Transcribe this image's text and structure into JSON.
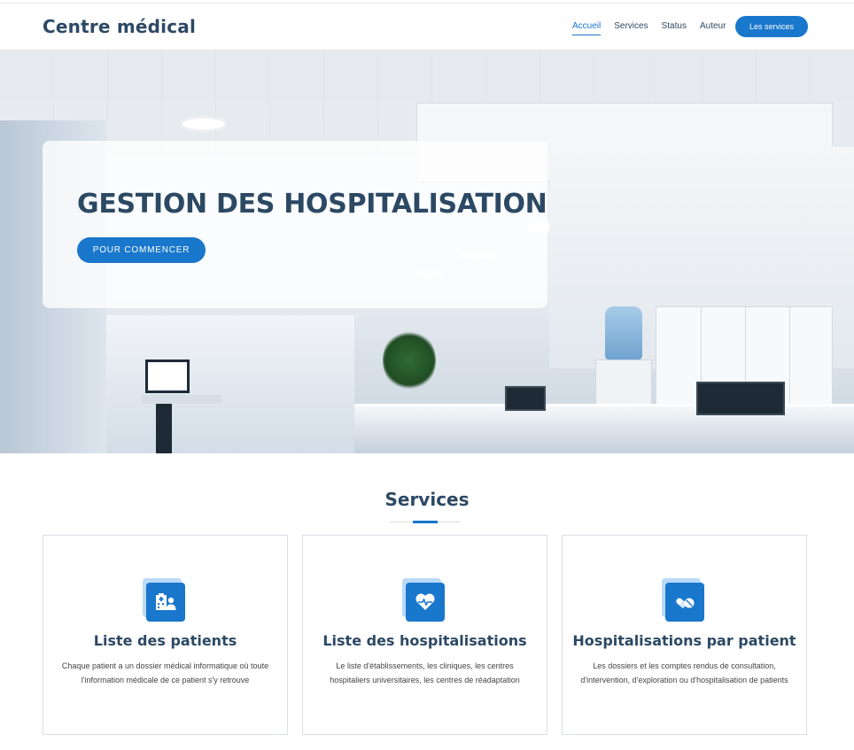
{
  "header": {
    "logo": "Centre médical",
    "nav": [
      {
        "label": "Accueil",
        "active": true
      },
      {
        "label": "Services",
        "active": false
      },
      {
        "label": "Status",
        "active": false
      },
      {
        "label": "Auteur",
        "active": false
      }
    ],
    "cta_label": "Les services"
  },
  "hero": {
    "title": "GESTION DES HOSPITALISATION",
    "button_label": "POUR COMMENCER",
    "background_image": "hospital-lobby-photo"
  },
  "services": {
    "title": "Services",
    "cards": [
      {
        "icon": "hospital-user-icon",
        "title": "Liste des patients",
        "text": "Chaque patient a un dossier médical informatique où toute l'information médicale de ce patient s'y retrouve"
      },
      {
        "icon": "heartbeat-icon",
        "title": "Liste des hospitalisations",
        "text": "Le liste d'établissements, les cliniques, les centres hospitaliers universitaires, les centres de réadaptation"
      },
      {
        "icon": "pills-icon",
        "title": "Hospitalisations par patient",
        "text": "Les dossiers et les comptes rendus de consultation, d'intervention, d'exploration ou d'hospitalisation de patients"
      }
    ]
  },
  "colors": {
    "accent": "#1977cc",
    "heading": "#2c4964",
    "icon_back": "#badaf7"
  }
}
